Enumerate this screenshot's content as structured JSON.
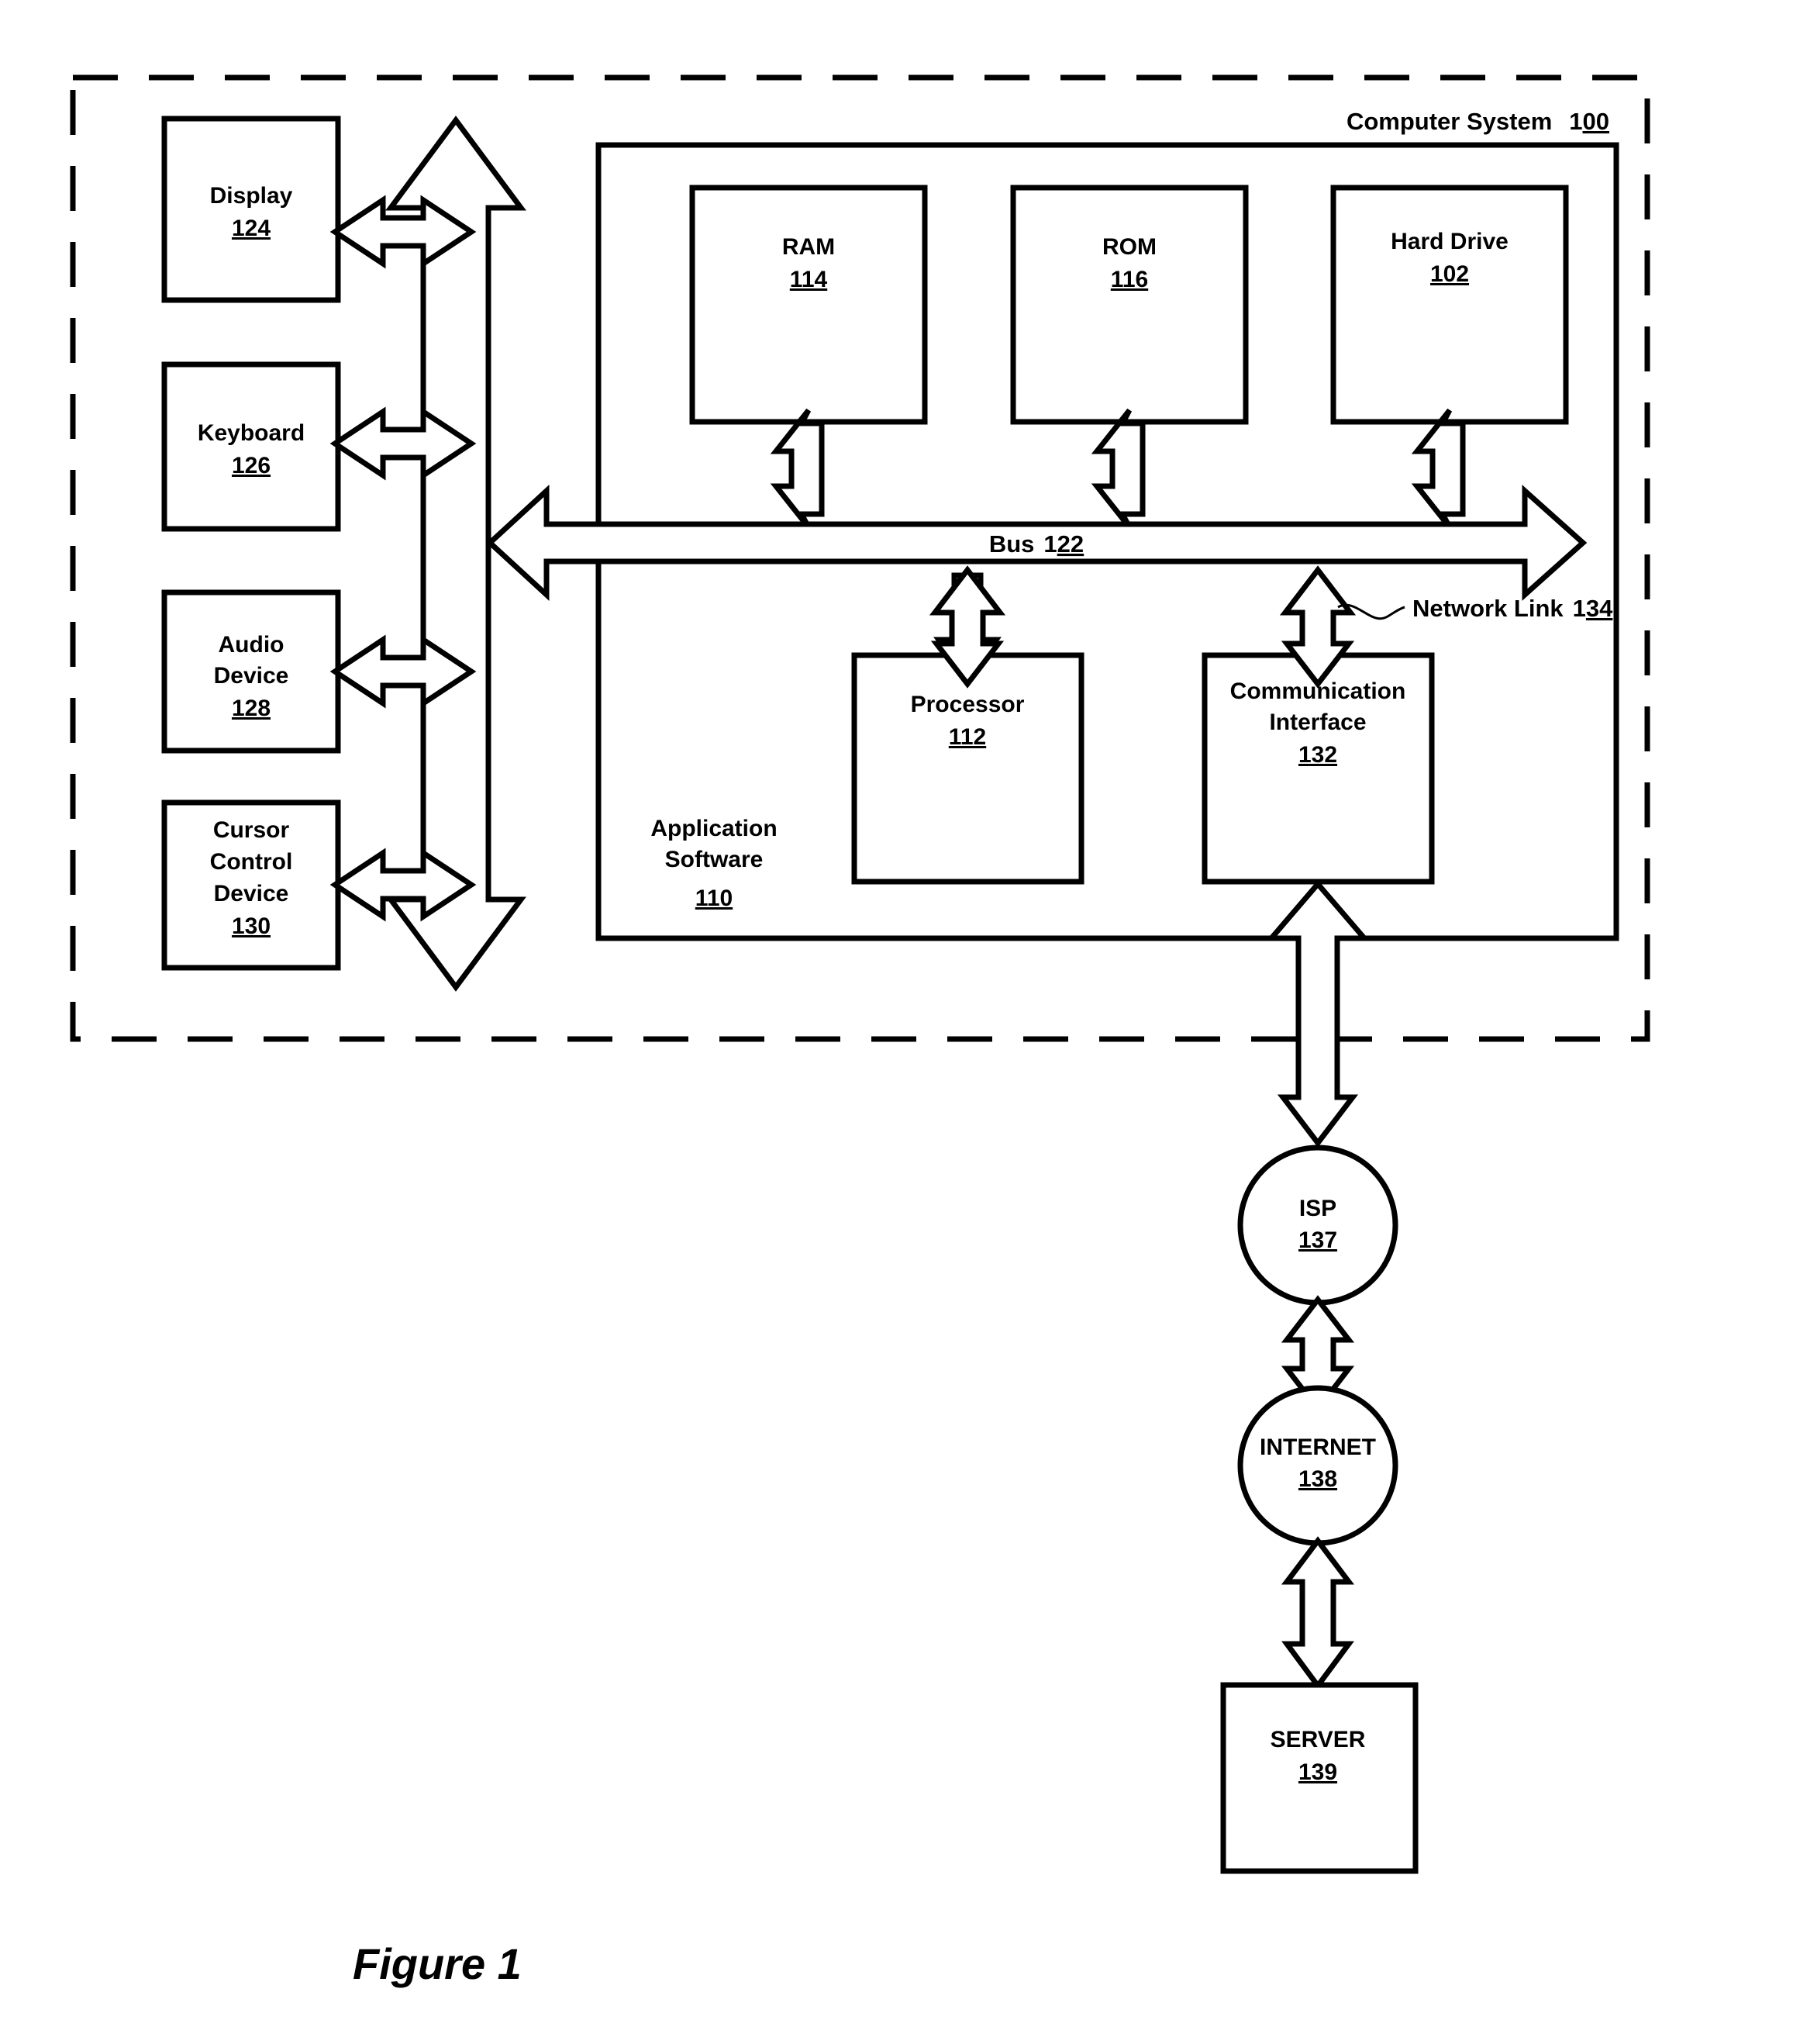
{
  "figure": {
    "caption": "Figure 1",
    "system_label_text": "Computer System",
    "system_label_num_plain": "1",
    "system_label_num_underlined": "00"
  },
  "peripherals": [
    {
      "name": "display",
      "line1": "Display",
      "line2": "",
      "line3": "",
      "num": "124"
    },
    {
      "name": "keyboard",
      "line1": "Keyboard",
      "line2": "",
      "line3": "",
      "num": "126"
    },
    {
      "name": "audio-device",
      "line1": "Audio",
      "line2": "Device",
      "line3": "",
      "num": "128"
    },
    {
      "name": "cursor-control",
      "line1": "Cursor",
      "line2": "Control",
      "line3": "Device",
      "num": "130"
    }
  ],
  "memory_blocks": [
    {
      "name": "ram",
      "label": "RAM",
      "num": "114"
    },
    {
      "name": "rom",
      "label": "ROM",
      "num": "116"
    },
    {
      "name": "hard-drive",
      "label": "Hard Drive",
      "num": "102"
    }
  ],
  "core_blocks": [
    {
      "name": "processor",
      "line1": "Processor",
      "line2": "",
      "num": "112"
    },
    {
      "name": "communication-interface",
      "line1": "Communication",
      "line2": "Interface",
      "num": "132"
    }
  ],
  "bus": {
    "label_text": "Bus",
    "num_plain": "1",
    "num_underlined": "22"
  },
  "network_link": {
    "label_text": "Network Link",
    "num_plain": "1",
    "num_underlined": "34"
  },
  "application_software": {
    "line1": "Application",
    "line2": "Software",
    "num": "110"
  },
  "network_nodes": [
    {
      "name": "isp",
      "shape": "circle",
      "label": "ISP",
      "num": "137"
    },
    {
      "name": "internet",
      "shape": "circle",
      "label": "INTERNET",
      "num": "138"
    },
    {
      "name": "server",
      "shape": "rect",
      "label": "SERVER",
      "num": "139"
    }
  ],
  "colors": {
    "ink": "#000000",
    "paper": "#ffffff"
  }
}
